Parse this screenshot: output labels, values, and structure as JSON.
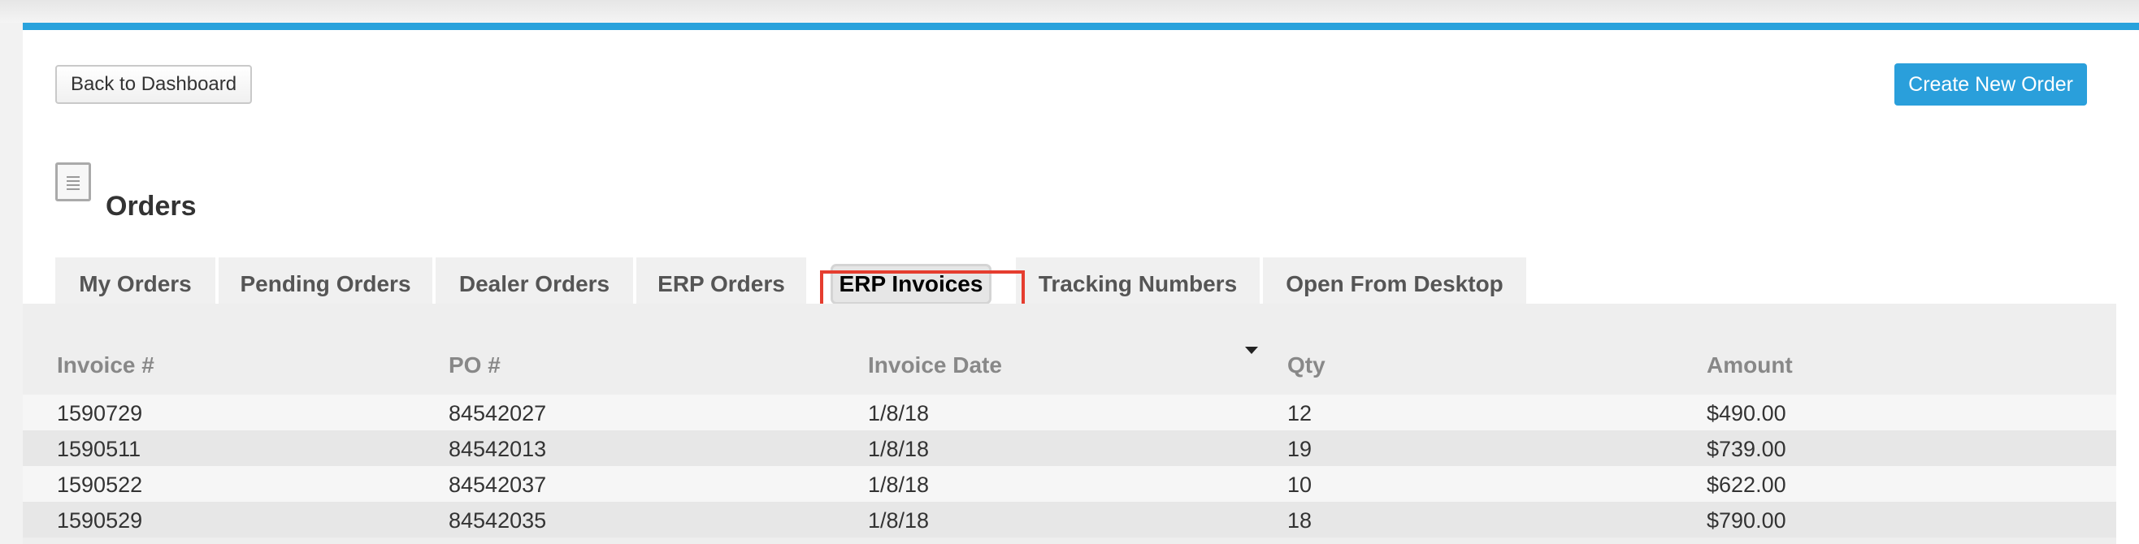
{
  "toolbar": {
    "back_label": "Back to Dashboard",
    "create_label": "Create New Order"
  },
  "page": {
    "title": "Orders",
    "title_icon": "document-lines-icon"
  },
  "tabs": [
    {
      "label": "My Orders",
      "active": false
    },
    {
      "label": "Pending Orders",
      "active": false
    },
    {
      "label": "Dealer Orders",
      "active": false
    },
    {
      "label": "ERP Orders",
      "active": false
    },
    {
      "label": "ERP Invoices",
      "active": true
    },
    {
      "label": "Tracking Numbers",
      "active": false
    },
    {
      "label": "Open From Desktop",
      "active": false
    }
  ],
  "table": {
    "columns": [
      "Invoice #",
      "PO #",
      "Invoice Date",
      "Qty",
      "Amount"
    ],
    "sort_column": "Invoice Date",
    "sort_direction": "descending",
    "rows": [
      [
        "1590729",
        "84542027",
        "1/8/18",
        "12",
        "$490.00"
      ],
      [
        "1590511",
        "84542013",
        "1/8/18",
        "19",
        "$739.00"
      ],
      [
        "1590522",
        "84542037",
        "1/8/18",
        "10",
        "$622.00"
      ],
      [
        "1590529",
        "84542035",
        "1/8/18",
        "18",
        "$790.00"
      ]
    ]
  },
  "colors": {
    "accent": "#29a2dc",
    "primary_button": "#2a9fdb",
    "highlight": "#e53d2f"
  }
}
